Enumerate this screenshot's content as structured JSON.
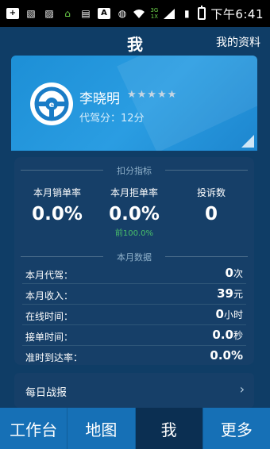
{
  "status_bar": {
    "icons": [
      "plus-box-icon",
      "image-text-icon",
      "image-icon",
      "lock-icon",
      "gallery-icon",
      "a-box-icon",
      "globe-icon",
      "wifi-icon",
      "signal-icon",
      "sim-icon",
      "battery-icon"
    ],
    "network_top": "3G",
    "network_bottom": "1X",
    "time": "下午6:41"
  },
  "header": {
    "title": "我",
    "profile_link": "我的资料"
  },
  "profile": {
    "name": "李晓明",
    "stars_total": 5,
    "stars_filled": 0,
    "stars_text": "★★★★★",
    "score_text": "代驾分：12分"
  },
  "metrics": {
    "section_deduct": "扣分指标",
    "kpis": [
      {
        "label": "本月销单率",
        "value": "0.0%",
        "sub": ""
      },
      {
        "label": "本月拒单率",
        "value": "0.0%",
        "sub": "前100.0%"
      },
      {
        "label": "投诉数",
        "value": "0",
        "sub": ""
      }
    ],
    "section_month": "本月数据",
    "rows": [
      {
        "label": "本月代驾：",
        "value": "0",
        "unit": "次"
      },
      {
        "label": "本月收入：",
        "value": "39",
        "unit": "元"
      },
      {
        "label": "在线时间：",
        "value": "0",
        "unit": "小时"
      },
      {
        "label": "接单时间：",
        "value": "0.0",
        "unit": "秒"
      },
      {
        "label": "准时到达率：",
        "value": "0.0%",
        "unit": ""
      }
    ]
  },
  "daily_report": {
    "label": "每日战报",
    "chevron": "›"
  },
  "bottom_nav": {
    "items": [
      "工作台",
      "地图",
      "我",
      "更多"
    ],
    "active": "我"
  },
  "colors": {
    "background": "#0f3d66",
    "card_blue": "#2a9de2",
    "panel": "#163f68",
    "nav": "#1670b6",
    "nav_active": "#0b2f52",
    "green": "#49c06a"
  }
}
